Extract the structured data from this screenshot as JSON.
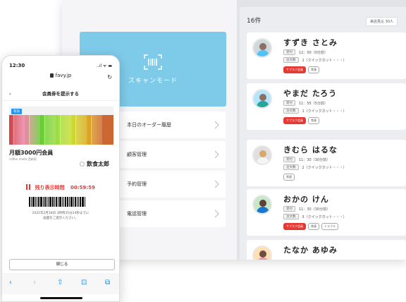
{
  "tablet": {
    "scan_label": "スキャンモード",
    "menu": [
      {
        "label": "本日のオーダー履歴"
      },
      {
        "label": "顧客管理"
      },
      {
        "label": "予約管理"
      },
      {
        "label": "電話管理"
      }
    ],
    "count": "16件",
    "wait_badge": "来店見込 30人",
    "customers": [
      {
        "name": "すずき さとみ",
        "reception_tag": "受付",
        "reception": "12：00（0分前）",
        "order_tag": "注文数",
        "order": "1（クイックホット・・・）",
        "badges": [
          {
            "label": "サブスク会員",
            "red": true
          },
          {
            "label": "常連",
            "red": false
          }
        ]
      },
      {
        "name": "やまだ たろう",
        "reception_tag": "受付",
        "reception": "11：55（5分前）",
        "order_tag": "注文数",
        "order": "1（クイックホット・・・）",
        "badges": [
          {
            "label": "サブスク会員",
            "red": true
          },
          {
            "label": "常連",
            "red": false
          }
        ]
      },
      {
        "name": "きむら はるな",
        "reception_tag": "受付",
        "reception": "11：30（30分前）",
        "order_tag": "注文数",
        "order": "2（クイックホット・・・）",
        "badges": [
          {
            "label": "常連",
            "red": false
          }
        ]
      },
      {
        "name": "おかの けん",
        "reception_tag": "受付",
        "reception": "11：30（30分前）",
        "order_tag": "注文数",
        "order": "3（クイックホット・・・）",
        "badges": [
          {
            "label": "サブスク会員",
            "red": true
          },
          {
            "label": "常連",
            "red": false
          },
          {
            "label": "トラブル",
            "red": false
          }
        ]
      },
      {
        "name": "たなか あゆみ",
        "reception_tag": "",
        "reception": "",
        "order_tag": "",
        "order": "",
        "badges": []
      }
    ]
  },
  "phone": {
    "time": "12:30",
    "status_icons": "..ıl ᯤ ▬",
    "url": "favy.jp",
    "reload": "↻",
    "back": "‹",
    "title": "会員券を提示する",
    "promo_badge": "有効",
    "member_title": "月額3000円会員",
    "member_sub": "coffee matta 西新宿",
    "member_name": "飲食太郎",
    "timer_label": "残り表示時間",
    "timer_value": "00:59:59",
    "caption_line1": "2021年2月18日 1時時35分24秒までに",
    "caption_line2": "画面をご提示ください。",
    "close_label": "閉じる",
    "toolbar": {
      "back": "‹",
      "forward": "›",
      "share": "⇧",
      "bookmarks": "⊡",
      "tabs": "⧉"
    }
  },
  "colors": {
    "accent": "#7ecbe9",
    "alert": "#e53935",
    "link": "#1e88e5"
  }
}
